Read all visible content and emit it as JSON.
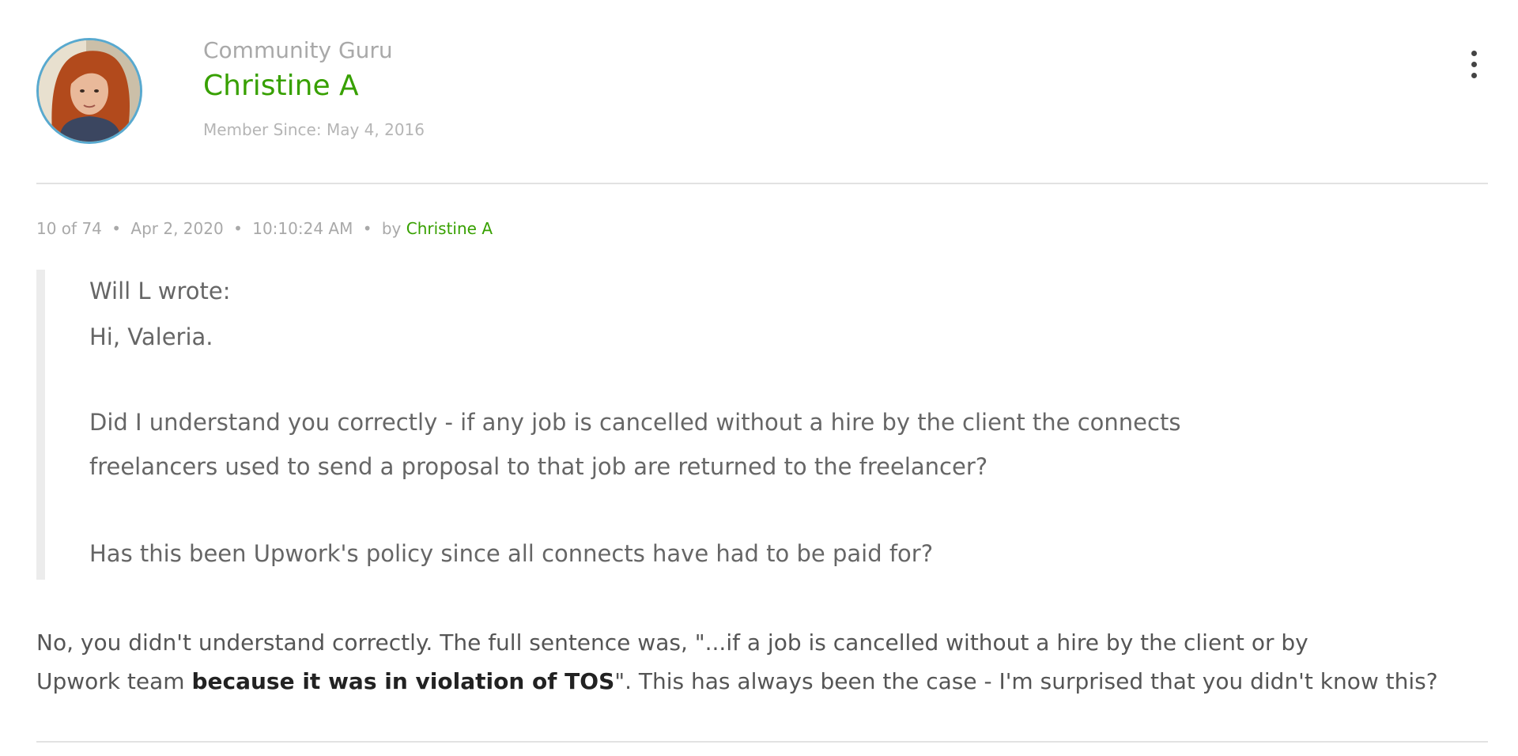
{
  "author": {
    "rank": "Community Guru",
    "name": "Christine A",
    "member_since": "Member Since: May 4, 2016"
  },
  "post_meta": {
    "position": "10 of 74",
    "date": "Apr 2, 2020",
    "time": "10:10:24 AM",
    "by_label": "by",
    "author": "Christine A"
  },
  "quote": {
    "attribution": "Will L wrote:",
    "greeting": "Hi, Valeria.",
    "question_line1": "Did I understand you correctly - if any job is cancelled without a hire by the client the connects",
    "question_line2": "freelancers used to send a proposal to that job are returned to the freelancer?",
    "question2": "Has this been Upwork's policy since all connects have had to be paid for?"
  },
  "reply": {
    "line1": "No, you didn't understand correctly. The full sentence was, \"...if a job is cancelled without a hire by the client or by",
    "line2_prefix": "Upwork team ",
    "line2_bold": "because it was in violation of TOS",
    "line2_suffix": "\". This has always been the case - I'm surprised that you didn't know this?"
  },
  "icons": {
    "menu": "more-vertical-icon",
    "avatar": "user-photo"
  },
  "colors": {
    "accent_green": "#37a000",
    "avatar_ring": "#58a9cf",
    "muted_text": "#a9a9a9",
    "quote_bar": "#ececec"
  }
}
